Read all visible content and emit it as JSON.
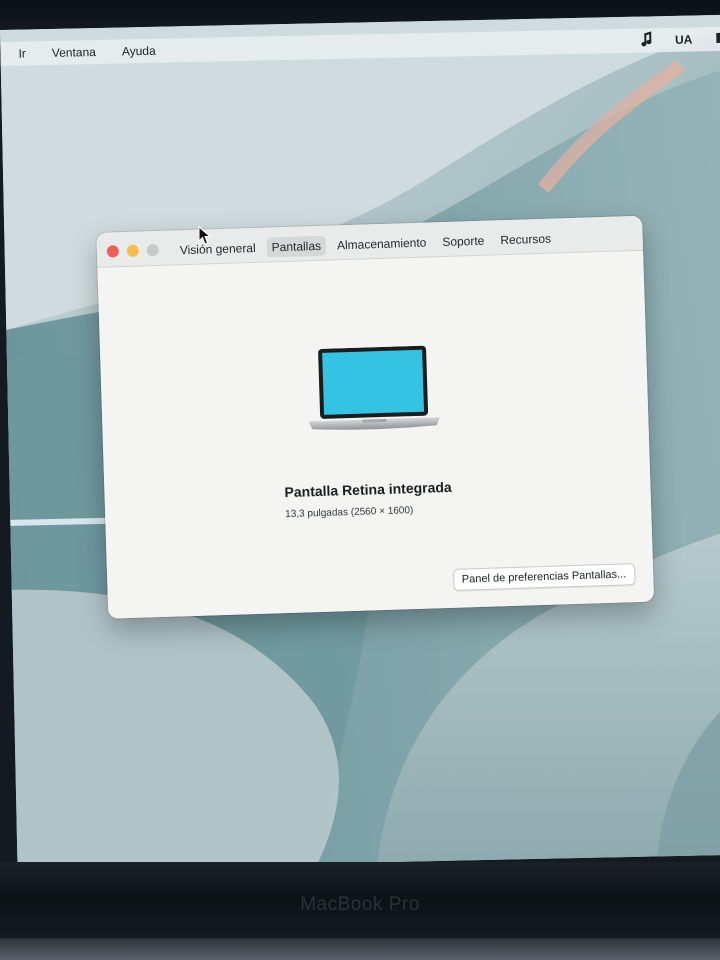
{
  "menubar": {
    "items": [
      "Ir",
      "Ventana",
      "Ayuda"
    ],
    "status_text": "UA",
    "status_icons": [
      "music-note-icon",
      "keyboard-flag-icon"
    ]
  },
  "window": {
    "traffic_lights": {
      "close_color": "#ed5f57",
      "minimize_color": "#f5bd4e",
      "zoom_color": "#c9c9c9"
    },
    "tabs": [
      {
        "label": "Visión general",
        "selected": false
      },
      {
        "label": "Pantallas",
        "selected": true
      },
      {
        "label": "Almacenamiento",
        "selected": false
      },
      {
        "label": "Soporte",
        "selected": false
      },
      {
        "label": "Recursos",
        "selected": false
      }
    ],
    "display": {
      "icon": "laptop-icon",
      "name": "Pantalla Retina integrada",
      "size": "13,3 pulgadas (2560 × 1600)"
    },
    "prefs_button_label": "Panel de preferencias Pantallas..."
  },
  "bezel": {
    "brand": "MacBook Pro"
  },
  "colors": {
    "laptop_screen": "#35c3e4",
    "window_bg": "#f4f4f3"
  }
}
